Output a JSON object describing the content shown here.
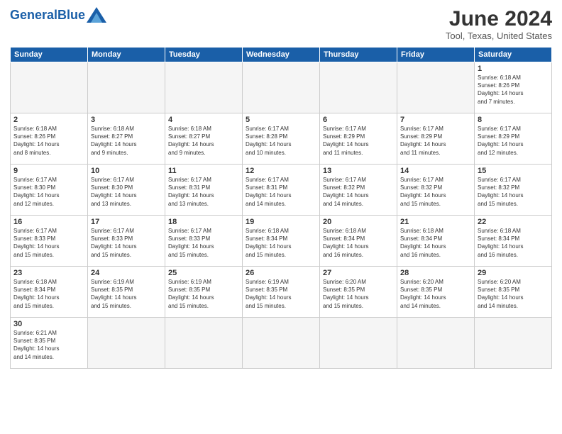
{
  "logo": {
    "text_normal": "General",
    "text_bold": "Blue"
  },
  "title": "June 2024",
  "location": "Tool, Texas, United States",
  "days_of_week": [
    "Sunday",
    "Monday",
    "Tuesday",
    "Wednesday",
    "Thursday",
    "Friday",
    "Saturday"
  ],
  "weeks": [
    [
      {
        "day": "",
        "info": ""
      },
      {
        "day": "",
        "info": ""
      },
      {
        "day": "",
        "info": ""
      },
      {
        "day": "",
        "info": ""
      },
      {
        "day": "",
        "info": ""
      },
      {
        "day": "",
        "info": ""
      },
      {
        "day": "1",
        "info": "Sunrise: 6:18 AM\nSunset: 8:26 PM\nDaylight: 14 hours\nand 7 minutes."
      }
    ],
    [
      {
        "day": "2",
        "info": "Sunrise: 6:18 AM\nSunset: 8:26 PM\nDaylight: 14 hours\nand 8 minutes."
      },
      {
        "day": "3",
        "info": "Sunrise: 6:18 AM\nSunset: 8:27 PM\nDaylight: 14 hours\nand 9 minutes."
      },
      {
        "day": "4",
        "info": "Sunrise: 6:18 AM\nSunset: 8:27 PM\nDaylight: 14 hours\nand 9 minutes."
      },
      {
        "day": "5",
        "info": "Sunrise: 6:17 AM\nSunset: 8:28 PM\nDaylight: 14 hours\nand 10 minutes."
      },
      {
        "day": "6",
        "info": "Sunrise: 6:17 AM\nSunset: 8:29 PM\nDaylight: 14 hours\nand 11 minutes."
      },
      {
        "day": "7",
        "info": "Sunrise: 6:17 AM\nSunset: 8:29 PM\nDaylight: 14 hours\nand 11 minutes."
      },
      {
        "day": "8",
        "info": "Sunrise: 6:17 AM\nSunset: 8:29 PM\nDaylight: 14 hours\nand 12 minutes."
      }
    ],
    [
      {
        "day": "9",
        "info": "Sunrise: 6:17 AM\nSunset: 8:30 PM\nDaylight: 14 hours\nand 12 minutes."
      },
      {
        "day": "10",
        "info": "Sunrise: 6:17 AM\nSunset: 8:30 PM\nDaylight: 14 hours\nand 13 minutes."
      },
      {
        "day": "11",
        "info": "Sunrise: 6:17 AM\nSunset: 8:31 PM\nDaylight: 14 hours\nand 13 minutes."
      },
      {
        "day": "12",
        "info": "Sunrise: 6:17 AM\nSunset: 8:31 PM\nDaylight: 14 hours\nand 14 minutes."
      },
      {
        "day": "13",
        "info": "Sunrise: 6:17 AM\nSunset: 8:32 PM\nDaylight: 14 hours\nand 14 minutes."
      },
      {
        "day": "14",
        "info": "Sunrise: 6:17 AM\nSunset: 8:32 PM\nDaylight: 14 hours\nand 15 minutes."
      },
      {
        "day": "15",
        "info": "Sunrise: 6:17 AM\nSunset: 8:32 PM\nDaylight: 14 hours\nand 15 minutes."
      }
    ],
    [
      {
        "day": "16",
        "info": "Sunrise: 6:17 AM\nSunset: 8:33 PM\nDaylight: 14 hours\nand 15 minutes."
      },
      {
        "day": "17",
        "info": "Sunrise: 6:17 AM\nSunset: 8:33 PM\nDaylight: 14 hours\nand 15 minutes."
      },
      {
        "day": "18",
        "info": "Sunrise: 6:17 AM\nSunset: 8:33 PM\nDaylight: 14 hours\nand 15 minutes."
      },
      {
        "day": "19",
        "info": "Sunrise: 6:18 AM\nSunset: 8:34 PM\nDaylight: 14 hours\nand 15 minutes."
      },
      {
        "day": "20",
        "info": "Sunrise: 6:18 AM\nSunset: 8:34 PM\nDaylight: 14 hours\nand 16 minutes."
      },
      {
        "day": "21",
        "info": "Sunrise: 6:18 AM\nSunset: 8:34 PM\nDaylight: 14 hours\nand 16 minutes."
      },
      {
        "day": "22",
        "info": "Sunrise: 6:18 AM\nSunset: 8:34 PM\nDaylight: 14 hours\nand 16 minutes."
      }
    ],
    [
      {
        "day": "23",
        "info": "Sunrise: 6:18 AM\nSunset: 8:34 PM\nDaylight: 14 hours\nand 15 minutes."
      },
      {
        "day": "24",
        "info": "Sunrise: 6:19 AM\nSunset: 8:35 PM\nDaylight: 14 hours\nand 15 minutes."
      },
      {
        "day": "25",
        "info": "Sunrise: 6:19 AM\nSunset: 8:35 PM\nDaylight: 14 hours\nand 15 minutes."
      },
      {
        "day": "26",
        "info": "Sunrise: 6:19 AM\nSunset: 8:35 PM\nDaylight: 14 hours\nand 15 minutes."
      },
      {
        "day": "27",
        "info": "Sunrise: 6:20 AM\nSunset: 8:35 PM\nDaylight: 14 hours\nand 15 minutes."
      },
      {
        "day": "28",
        "info": "Sunrise: 6:20 AM\nSunset: 8:35 PM\nDaylight: 14 hours\nand 14 minutes."
      },
      {
        "day": "29",
        "info": "Sunrise: 6:20 AM\nSunset: 8:35 PM\nDaylight: 14 hours\nand 14 minutes."
      }
    ],
    [
      {
        "day": "30",
        "info": "Sunrise: 6:21 AM\nSunset: 8:35 PM\nDaylight: 14 hours\nand 14 minutes."
      },
      {
        "day": "",
        "info": ""
      },
      {
        "day": "",
        "info": ""
      },
      {
        "day": "",
        "info": ""
      },
      {
        "day": "",
        "info": ""
      },
      {
        "day": "",
        "info": ""
      },
      {
        "day": "",
        "info": ""
      }
    ]
  ],
  "colors": {
    "header_bg": "#1a5fa8",
    "header_text": "#ffffff",
    "border": "#cccccc",
    "empty_bg": "#f5f5f5"
  }
}
